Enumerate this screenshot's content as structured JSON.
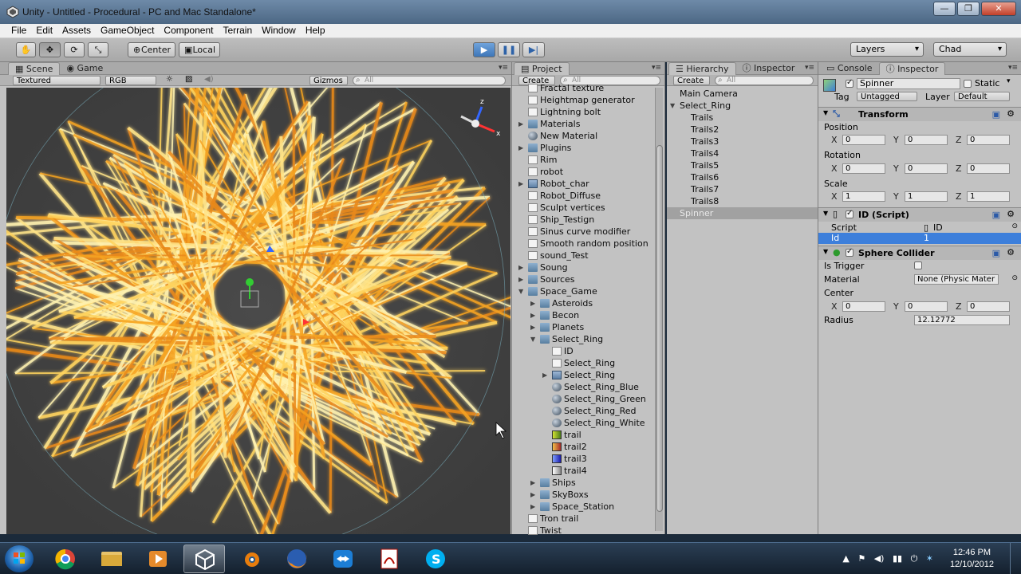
{
  "window": {
    "title": "Unity - Untitled - Procedural - PC and Mac Standalone*",
    "minimize": "—",
    "maximize": "❐",
    "close": "✕"
  },
  "menu": [
    "File",
    "Edit",
    "Assets",
    "GameObject",
    "Component",
    "Terrain",
    "Window",
    "Help"
  ],
  "toolbar": {
    "tools": [
      "✋",
      "✥",
      "⟳",
      "⤡"
    ],
    "pivot": "Center",
    "space": "Local",
    "play": "▶",
    "pause": "❚❚",
    "step": "▶|",
    "layers": "Layers",
    "layout": "Chad"
  },
  "scene_panel": {
    "tabs": [
      "Scene",
      "Game"
    ],
    "render_mode": "Textured",
    "color_mode": "RGB",
    "gizmos": "Gizmos",
    "search_placeholder": "All"
  },
  "project_panel": {
    "tab": "Project",
    "create": "Create",
    "search_placeholder": "All",
    "items": [
      {
        "label": "Fractal texture",
        "icon": "script",
        "indent": 0
      },
      {
        "label": "Heightmap generator",
        "icon": "script",
        "indent": 0
      },
      {
        "label": "Lightning bolt",
        "icon": "script",
        "indent": 0
      },
      {
        "label": "Materials",
        "icon": "folder",
        "indent": 0,
        "arrow": "▶"
      },
      {
        "label": "New Material",
        "icon": "mat",
        "indent": 0
      },
      {
        "label": "Plugins",
        "icon": "folder",
        "indent": 0,
        "arrow": "▶"
      },
      {
        "label": "Rim",
        "icon": "script",
        "indent": 0
      },
      {
        "label": "robot",
        "icon": "script",
        "indent": 0
      },
      {
        "label": "Robot_char",
        "icon": "prefab",
        "indent": 0,
        "arrow": "▶"
      },
      {
        "label": "Robot_Diffuse",
        "icon": "script",
        "indent": 0
      },
      {
        "label": "Sculpt vertices",
        "icon": "script",
        "indent": 0
      },
      {
        "label": "Ship_Testign",
        "icon": "script",
        "indent": 0
      },
      {
        "label": "Sinus curve modifier",
        "icon": "script",
        "indent": 0
      },
      {
        "label": "Smooth random position",
        "icon": "script",
        "indent": 0
      },
      {
        "label": "sound_Test",
        "icon": "script",
        "indent": 0
      },
      {
        "label": "Soung",
        "icon": "folder",
        "indent": 0,
        "arrow": "▶"
      },
      {
        "label": "Sources",
        "icon": "folder",
        "indent": 0,
        "arrow": "▶"
      },
      {
        "label": "Space_Game",
        "icon": "folder",
        "indent": 0,
        "arrow": "▼"
      },
      {
        "label": "Asteroids",
        "icon": "folder",
        "indent": 1,
        "arrow": "▶"
      },
      {
        "label": "Becon",
        "icon": "folder",
        "indent": 1,
        "arrow": "▶"
      },
      {
        "label": "Planets",
        "icon": "folder",
        "indent": 1,
        "arrow": "▶"
      },
      {
        "label": "Select_Ring",
        "icon": "folder",
        "indent": 1,
        "arrow": "▼"
      },
      {
        "label": "ID",
        "icon": "script",
        "indent": 2
      },
      {
        "label": "Select_Ring",
        "icon": "script",
        "indent": 2
      },
      {
        "label": "Select_Ring",
        "icon": "prefab",
        "indent": 2,
        "arrow": "▶"
      },
      {
        "label": "Select_Ring_Blue",
        "icon": "mat",
        "indent": 2
      },
      {
        "label": "Select_Ring_Green",
        "icon": "mat",
        "indent": 2
      },
      {
        "label": "Select_Ring_Red",
        "icon": "mat",
        "indent": 2
      },
      {
        "label": "Select_Ring_White",
        "icon": "mat",
        "indent": 2
      },
      {
        "label": "trail",
        "icon": "tex1",
        "indent": 2
      },
      {
        "label": "trail2",
        "icon": "tex2",
        "indent": 2
      },
      {
        "label": "trail3",
        "icon": "tex3",
        "indent": 2
      },
      {
        "label": "trail4",
        "icon": "tex4",
        "indent": 2
      },
      {
        "label": "Ships",
        "icon": "folder",
        "indent": 1,
        "arrow": "▶"
      },
      {
        "label": "SkyBoxs",
        "icon": "folder",
        "indent": 1,
        "arrow": "▶"
      },
      {
        "label": "Space_Station",
        "icon": "folder",
        "indent": 1,
        "arrow": "▶"
      },
      {
        "label": "Tron trail",
        "icon": "script",
        "indent": 0
      },
      {
        "label": "Twist",
        "icon": "script",
        "indent": 0
      }
    ]
  },
  "hierarchy_panel": {
    "tabs": [
      "Hierarchy",
      "Inspector"
    ],
    "create": "Create",
    "search_placeholder": "All",
    "items": [
      {
        "label": "Main Camera",
        "indent": 0
      },
      {
        "label": "Select_Ring",
        "indent": 0,
        "arrow": "▼"
      },
      {
        "label": "Trails",
        "indent": 1
      },
      {
        "label": "Trails2",
        "indent": 1
      },
      {
        "label": "Trails3",
        "indent": 1
      },
      {
        "label": "Trails4",
        "indent": 1
      },
      {
        "label": "Trails5",
        "indent": 1
      },
      {
        "label": "Trails6",
        "indent": 1
      },
      {
        "label": "Trails7",
        "indent": 1
      },
      {
        "label": "Trails8",
        "indent": 1
      },
      {
        "label": "Spinner",
        "indent": 0,
        "selected": true
      }
    ]
  },
  "inspector_panel": {
    "tabs": [
      "Console",
      "Inspector"
    ],
    "object_name": "Spinner",
    "static_label": "Static",
    "tag_label": "Tag",
    "tag_value": "Untagged",
    "layer_label": "Layer",
    "layer_value": "Default",
    "transform": {
      "title": "Transform",
      "position_label": "Position",
      "position": [
        "0",
        "0",
        "0"
      ],
      "rotation_label": "Rotation",
      "rotation": [
        "0",
        "0",
        "0"
      ],
      "scale_label": "Scale",
      "scale": [
        "1",
        "1",
        "1"
      ]
    },
    "axes": [
      "X",
      "Y",
      "Z"
    ],
    "id_script": {
      "title": "ID (Script)",
      "script_label": "Script",
      "script_value": "ID",
      "id_label": "Id",
      "id_value": "1"
    },
    "sphere_collider": {
      "title": "Sphere Collider",
      "trigger_label": "Is Trigger",
      "material_label": "Material",
      "material_value": "None (Physic Mater",
      "center_label": "Center",
      "center": [
        "0",
        "0",
        "0"
      ],
      "radius_label": "Radius",
      "radius_value": "12.12772"
    }
  },
  "taskbar": {
    "time": "12:46 PM",
    "date": "12/10/2012"
  }
}
